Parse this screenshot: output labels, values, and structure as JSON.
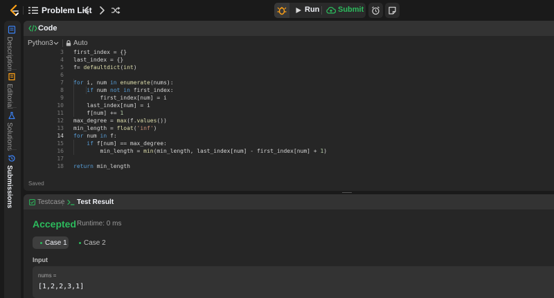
{
  "topbar": {
    "title": "Problem List",
    "run_label": "Run",
    "submit_label": "Submit",
    "icons": {
      "logo": "leetcode-logo",
      "list": "list-icon",
      "prev": "chevron-left-icon",
      "next": "chevron-right-icon",
      "shuffle": "shuffle-icon",
      "debug": "debug-icon",
      "run": "play-icon",
      "submit": "cloud-upload-icon",
      "alarm": "alarm-clock-icon",
      "note": "note-icon"
    }
  },
  "side_tabs": [
    {
      "label": "Description",
      "icon": "description-icon",
      "active": false
    },
    {
      "label": "Editorial",
      "icon": "editorial-icon",
      "active": false
    },
    {
      "label": "Solutions",
      "icon": "flask-icon",
      "active": false
    },
    {
      "label": "Submissions",
      "icon": "history-icon",
      "active": true
    }
  ],
  "editor": {
    "title": "Code",
    "language": "Python3",
    "mode": "Auto",
    "status": "Saved",
    "current_line": 14,
    "lines": [
      {
        "n": "3",
        "text": "first_index = {}"
      },
      {
        "n": "4",
        "text": "last_index = {}"
      },
      {
        "n": "5",
        "text": "f= defaultdict(int)"
      },
      {
        "n": "6",
        "text": ""
      },
      {
        "n": "7",
        "text": "for i, num in enumerate(nums):"
      },
      {
        "n": "8",
        "text": "    if num not in first_index:"
      },
      {
        "n": "9",
        "text": "        first_index[num] = i"
      },
      {
        "n": "10",
        "text": "    last_index[num] = i"
      },
      {
        "n": "11",
        "text": "    f[num] += 1"
      },
      {
        "n": "12",
        "text": "max_degree = max(f.values())"
      },
      {
        "n": "13",
        "text": "min_length = float('inf')"
      },
      {
        "n": "14",
        "text": "for num in f:"
      },
      {
        "n": "15",
        "text": "    if f[num] == max_degree:"
      },
      {
        "n": "16",
        "text": "        min_length = min(min_length, last_index[num] - first_index[num] + 1)"
      },
      {
        "n": "17",
        "text": ""
      },
      {
        "n": "18",
        "text": "return min_length"
      }
    ]
  },
  "result": {
    "testcase_tab": "Testcase",
    "result_tab": "Test Result",
    "status": "Accepted",
    "runtime": "Runtime: 0 ms",
    "cases": [
      "Case 1",
      "Case 2"
    ],
    "input_label": "Input",
    "var_name": "nums =",
    "var_value": "[1,2,2,3,1]",
    "colors": {
      "accent": "#2cbb5d"
    }
  }
}
